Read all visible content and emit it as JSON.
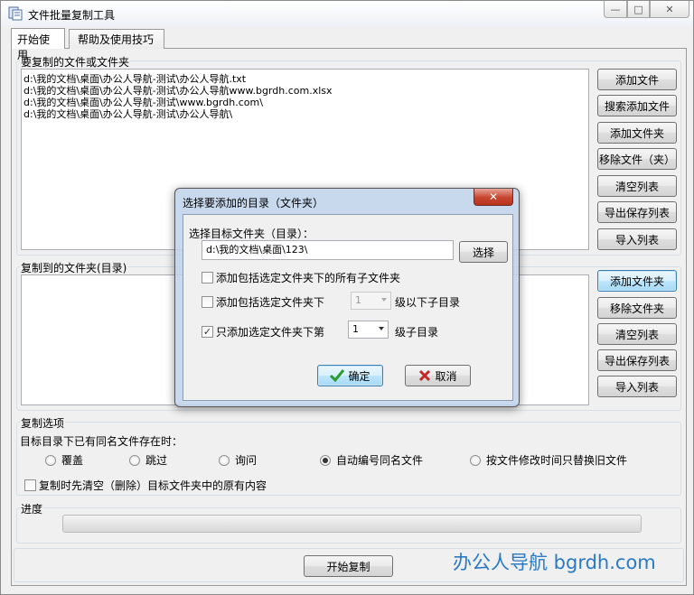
{
  "window": {
    "title": "文件批量复制工具",
    "controls": {
      "minimize": "—",
      "maximize": "□",
      "close": "✕"
    }
  },
  "tabs": [
    {
      "label": "开始使用",
      "active": true
    },
    {
      "label": "帮助及使用技巧",
      "active": false
    }
  ],
  "source": {
    "label": "要复制的文件或文件夹",
    "items": [
      "d:\\我的文档\\桌面\\办公人导航-测试\\办公人导航.txt",
      "d:\\我的文档\\桌面\\办公人导航-测试\\办公人导航www.bgrdh.com.xlsx",
      "d:\\我的文档\\桌面\\办公人导航-测试\\www.bgrdh.com\\",
      "d:\\我的文档\\桌面\\办公人导航-测试\\办公人导航\\"
    ],
    "buttons": {
      "add_file": "添加文件",
      "search_add_file": "搜索添加文件",
      "add_folder": "添加文件夹",
      "remove": "移除文件（夹）",
      "clear": "清空列表",
      "export": "导出保存列表",
      "import": "导入列表"
    }
  },
  "dest": {
    "label": "复制到的文件夹(目录)",
    "buttons": {
      "add_folder": "添加文件夹",
      "remove_folder": "移除文件夹",
      "clear": "清空列表",
      "export": "导出保存列表",
      "import": "导入列表"
    }
  },
  "options": {
    "label": "复制选项",
    "conflict_label": "目标目录下已有同名文件存在时：",
    "radios": [
      {
        "label": "覆盖",
        "checked": false
      },
      {
        "label": "跳过",
        "checked": false
      },
      {
        "label": "询问",
        "checked": false
      },
      {
        "label": "自动编号同名文件",
        "checked": true
      },
      {
        "label": "按文件修改时间只替换旧文件",
        "checked": false
      }
    ],
    "clear_first": {
      "label": "复制时先清空（删除）目标文件夹中的原有内容",
      "checked": false
    }
  },
  "progress": {
    "label": "进度",
    "value": 0
  },
  "start_button": "开始复制",
  "brand": "办公人导航 bgrdh.com",
  "dialog": {
    "title": "选择要添加的目录（文件夹）",
    "close": "✕",
    "target_label": "选择目标文件夹（目录）：",
    "target_value": "d:\\我的文档\\桌面\\123\\",
    "select_button": "选择",
    "opt_all_sub": {
      "label": "添加包括选定文件夹下的所有子文件夹",
      "checked": false
    },
    "opt_levels": {
      "label": "添加包括选定文件夹下",
      "value": "1",
      "suffix": "级以下子目录",
      "checked": false
    },
    "opt_only": {
      "label": "只添加选定文件夹下第",
      "value": "1",
      "suffix": "级子目录",
      "checked": true
    },
    "ok": "确定",
    "cancel": "取消"
  },
  "colors": {
    "accent": "#3c7fb1",
    "brand": "#2a79c3",
    "ok_icon": "#2e9b2e",
    "cancel_icon": "#c0282a"
  }
}
